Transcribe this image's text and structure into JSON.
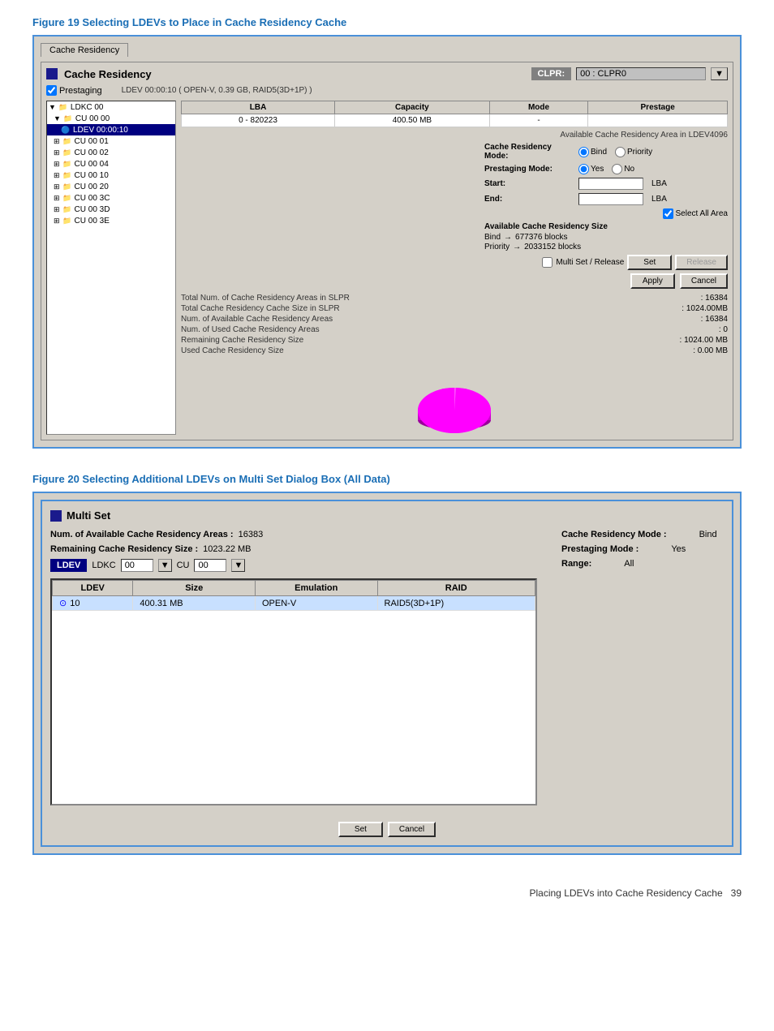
{
  "fig19": {
    "title": "Figure 19 Selecting LDEVs to Place in Cache Residency Cache",
    "panel_tab": "Cache Residency",
    "panel_heading": "Cache Residency",
    "clpr_label": "CLPR:",
    "clpr_value": "00 : CLPR0",
    "prestaging_checked": true,
    "prestaging_label": "Prestaging",
    "ldev_info": "LDEV 00:00:10 ( OPEN-V, 0.39 GB, RAID5(3D+1P) )",
    "table": {
      "headers": [
        "LBA",
        "Capacity",
        "Mode",
        "Prestage"
      ],
      "rows": [
        [
          "0 - 820223",
          "400.50 MB",
          "-",
          ""
        ]
      ]
    },
    "available_text": "Available Cache Residency Area in LDEV4096",
    "stats": [
      {
        "label": "Total Num. of Cache Residency Areas in SLPR",
        "value": ": 16384"
      },
      {
        "label": "Total Cache Residency Cache Size in SLPR",
        "value": ": 1024.00MB"
      },
      {
        "label": "Num. of Available Cache Residency Areas",
        "value": ": 16384"
      },
      {
        "label": "Num. of Used Cache Residency Areas",
        "value": ": 0"
      },
      {
        "label": "Remaining Cache Residency Size",
        "value": ": 1024.00 MB"
      },
      {
        "label": "Used Cache Residency Size",
        "value": ": 0.00 MB"
      }
    ],
    "cache_mode_label": "Cache Residency Mode:",
    "cache_mode_options": [
      "Bind",
      "Priority"
    ],
    "cache_mode_selected": "Bind",
    "prestaging_mode_label": "Prestaging Mode:",
    "prestaging_mode_options": [
      "Yes",
      "No"
    ],
    "prestaging_mode_selected": "Yes",
    "start_label": "Start:",
    "end_label": "End:",
    "lba_label": "LBA",
    "select_all_label": "Select All Area",
    "avail_cache_title": "Available Cache Residency Size",
    "bind_label": "Bind",
    "priority_label": "Priority",
    "arrow": "→",
    "bind_value": "677376 blocks",
    "priority_value": "2033152 blocks",
    "multi_set_label": "Multi Set / Release",
    "set_button": "Set",
    "release_button": "Release",
    "apply_button": "Apply",
    "cancel_button": "Cancel",
    "tree": [
      {
        "label": "LDKC 00",
        "indent": 0,
        "icon": "folder",
        "expanded": true
      },
      {
        "label": "CU 00 00",
        "indent": 1,
        "icon": "folder",
        "expanded": true
      },
      {
        "label": "LDEV 00:00:10",
        "indent": 2,
        "icon": "ldev",
        "selected": true
      },
      {
        "label": "CU 00 01",
        "indent": 1,
        "icon": "folder",
        "expanded": true
      },
      {
        "label": "CU 00 02",
        "indent": 1,
        "icon": "folder",
        "expanded": true
      },
      {
        "label": "CU 00 04",
        "indent": 1,
        "icon": "folder",
        "expanded": true
      },
      {
        "label": "CU 00 10",
        "indent": 1,
        "icon": "folder",
        "expanded": true
      },
      {
        "label": "CU 00 20",
        "indent": 1,
        "icon": "folder",
        "expanded": true
      },
      {
        "label": "CU 00 3C",
        "indent": 1,
        "icon": "folder",
        "expanded": true
      },
      {
        "label": "CU 00 3D",
        "indent": 1,
        "icon": "folder",
        "expanded": true
      },
      {
        "label": "CU 00 3E",
        "indent": 1,
        "icon": "folder",
        "expanded": true
      }
    ]
  },
  "fig20": {
    "title": "Figure 20 Selecting Additional LDEVs on Multi Set Dialog Box (All Data)",
    "panel_heading": "Multi Set",
    "avail_areas_label": "Num. of Available Cache Residency Areas :",
    "avail_areas_value": "16383",
    "remaining_label": "Remaining Cache Residency Size :",
    "remaining_value": "1023.22 MB",
    "cache_mode_label": "Cache Residency Mode :",
    "cache_mode_value": "Bind",
    "prestaging_label": "Prestaging Mode :",
    "prestaging_value": "Yes",
    "ldev_label": "LDEV",
    "ldkc_label": "LDKC",
    "ldkc_value": "00",
    "cu_label": "CU",
    "cu_value": "00",
    "range_label": "Range:",
    "range_value": "All",
    "table": {
      "headers": [
        "LDEV",
        "Size",
        "Emulation",
        "RAID"
      ],
      "rows": [
        {
          "ldev": "10",
          "size": "400.31 MB",
          "emulation": "OPEN-V",
          "raid": "RAID5(3D+1P)",
          "selected": true
        }
      ]
    },
    "set_button": "Set",
    "cancel_button": "Cancel"
  },
  "footer": {
    "text": "Placing LDEVs into Cache Residency Cache",
    "page": "39"
  }
}
